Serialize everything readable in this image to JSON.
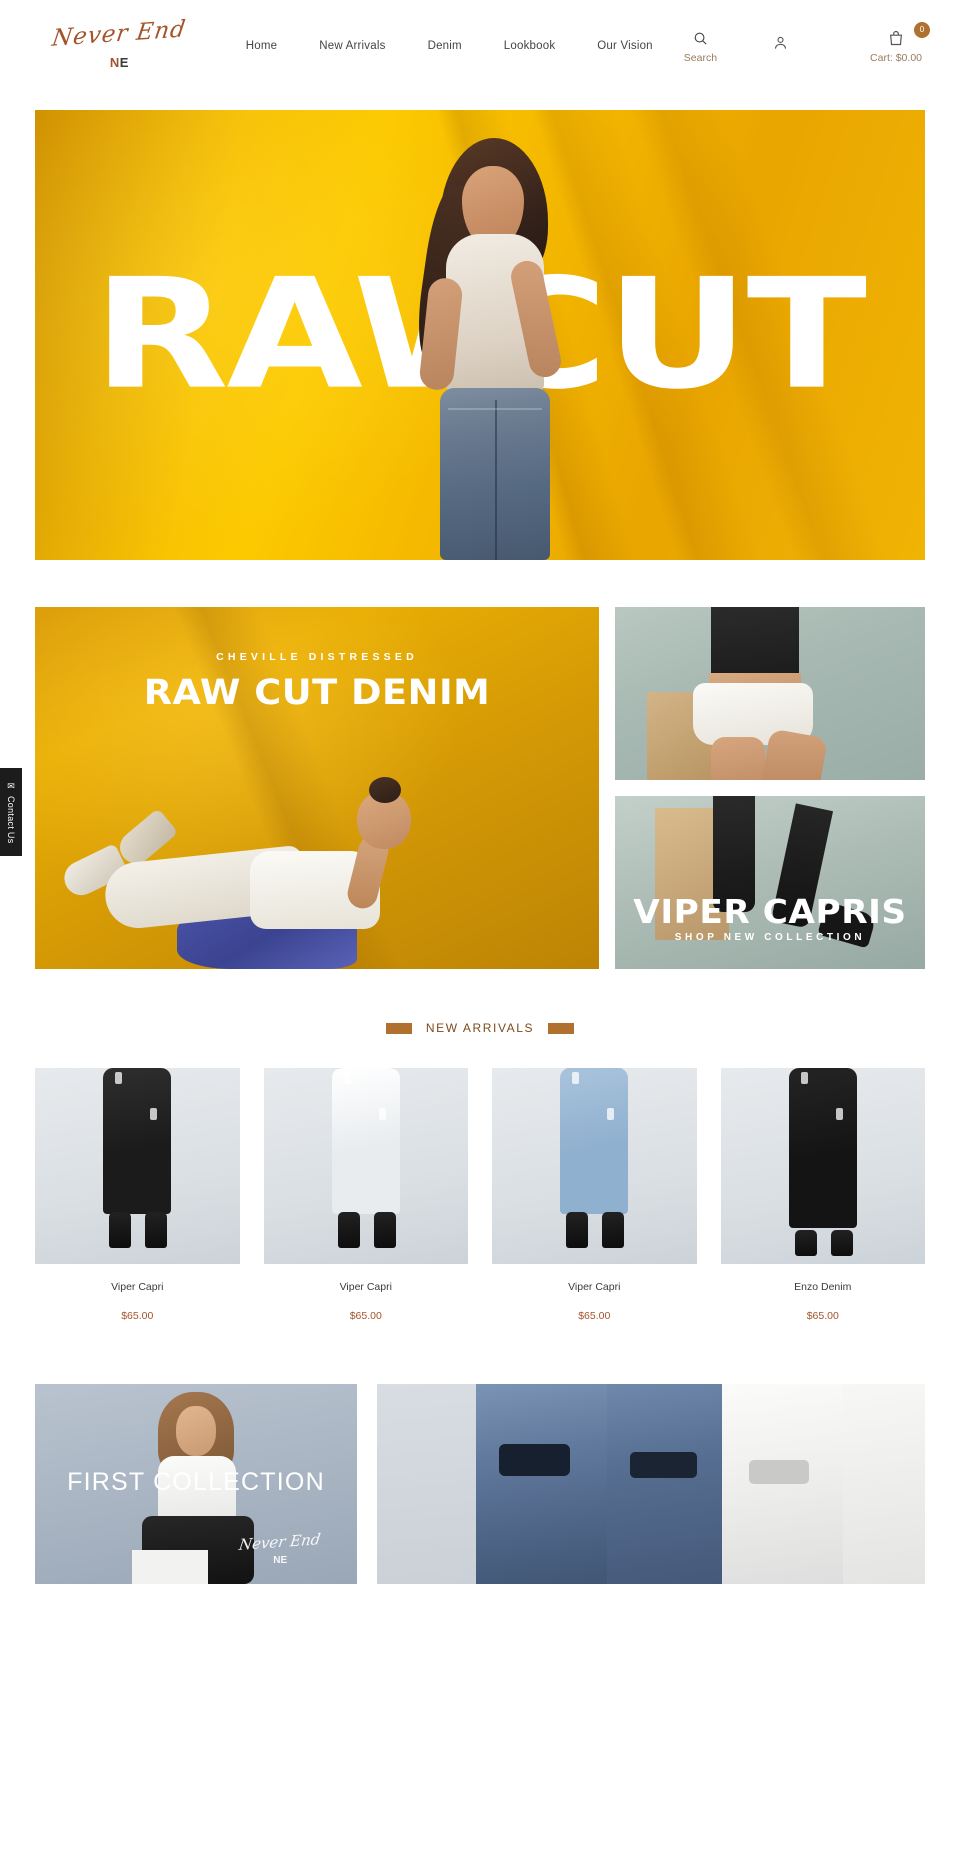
{
  "header": {
    "logo_script": "Never End",
    "logo_mark": "NE",
    "nav": [
      {
        "label": "Home"
      },
      {
        "label": "New Arrivals"
      },
      {
        "label": "Denim"
      },
      {
        "label": "Lookbook"
      },
      {
        "label": "Our Vision"
      }
    ],
    "search_label": "Search",
    "search_icon": "search-icon",
    "account_icon": "user-icon",
    "cart_icon": "shopping-bag-icon",
    "cart_badge": "0",
    "cart_label": "Cart: $0.00"
  },
  "hero": {
    "word_left": "RAW",
    "word_right": "CUT"
  },
  "promo": {
    "left": {
      "eyebrow": "CHEVILLE DISTRESSED",
      "headline": "RAW CUT DENIM"
    },
    "right_bottom": {
      "title": "VIPER CAPRIS",
      "subtitle": "SHOP NEW COLLECTION"
    }
  },
  "new_arrivals": {
    "section_title": "NEW ARRIVALS",
    "accent_color": "#b0702f",
    "products": [
      {
        "name": "Viper Capri",
        "price": "$65.00",
        "color": "#1b1b1b",
        "shade": "#2e2e2e"
      },
      {
        "name": "Viper Capri",
        "price": "$65.00",
        "color": "#e8ecef",
        "shade": "#ffffff"
      },
      {
        "name": "Viper Capri",
        "price": "$65.00",
        "color": "#8fb0cf",
        "shade": "#a9c3dc"
      },
      {
        "name": "Enzo Denim",
        "price": "$65.00",
        "color": "#141414",
        "shade": "#242424"
      }
    ]
  },
  "bottom": {
    "left_title": "FIRST COLLECTION",
    "left_sig_script": "Never End",
    "left_sig_mark": "NE"
  },
  "contact_tab": {
    "label": "Contact Us",
    "icon": "envelope-icon"
  }
}
